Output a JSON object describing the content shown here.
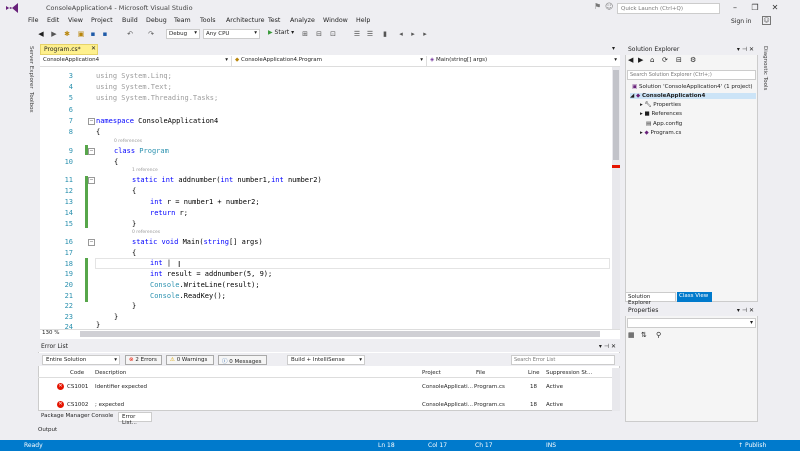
{
  "window": {
    "title": "ConsoleApplication4 - Microsoft Visual Studio",
    "quick_launch_placeholder": "Quick Launch (Ctrl+Q)",
    "sign_in": "Sign in"
  },
  "menu": [
    "File",
    "Edit",
    "View",
    "Project",
    "Build",
    "Debug",
    "Team",
    "Tools",
    "Architecture",
    "Test",
    "Analyze",
    "Window",
    "Help"
  ],
  "toolbar": {
    "config": "Debug",
    "platform": "Any CPU",
    "start": "Start"
  },
  "left_strip": [
    "Server Explorer",
    "Toolbox"
  ],
  "right_strip": [
    "Diagnostic Tools"
  ],
  "editor": {
    "tab_label": "Program.cs*",
    "nav_project": "ConsoleApplication4",
    "nav_class": "ConsoleApplication4.Program",
    "nav_member": "Main(string[] args)",
    "zoom": "130 %",
    "lines": [
      {
        "n": "3",
        "text": "using System.Linq;"
      },
      {
        "n": "4",
        "text": "using System.Text;"
      },
      {
        "n": "5",
        "text": "using System.Threading.Tasks;"
      },
      {
        "n": "6",
        "text": ""
      },
      {
        "n": "7",
        "text": "namespace ConsoleApplication4"
      },
      {
        "n": "8",
        "text": "{"
      },
      {
        "n": "9",
        "text": "class Program"
      },
      {
        "n": "10",
        "text": "{"
      },
      {
        "n": "11",
        "text": "static int addnumber(int number1,int number2)"
      },
      {
        "n": "12",
        "text": "{"
      },
      {
        "n": "13",
        "text": "int r = number1 + number2;"
      },
      {
        "n": "14",
        "text": "return r;"
      },
      {
        "n": "15",
        "text": "}"
      },
      {
        "n": "16",
        "text": "static void Main(string[] args)"
      },
      {
        "n": "17",
        "text": "{"
      },
      {
        "n": "18",
        "text": "int |"
      },
      {
        "n": "19",
        "text": "int result = addnumber(5, 9);"
      },
      {
        "n": "20",
        "text": "Console.WriteLine(result);"
      },
      {
        "n": "21",
        "text": "Console.ReadKey();"
      },
      {
        "n": "22",
        "text": "}"
      },
      {
        "n": "23",
        "text": "}"
      },
      {
        "n": "24",
        "text": "}"
      }
    ],
    "refs_0": "0 references",
    "refs_1": "1 reference",
    "refs_2": "0 references"
  },
  "solution_explorer": {
    "title": "Solution Explorer",
    "search_placeholder": "Search Solution Explorer (Ctrl+;)",
    "items": [
      "Solution 'ConsoleApplication4' (1 project)",
      "ConsoleApplication4",
      "Properties",
      "References",
      "App.config",
      "Program.cs"
    ],
    "tab_solution": "Solution Explorer",
    "tab_class": "Class View"
  },
  "properties": {
    "title": "Properties"
  },
  "error_list": {
    "title": "Error List",
    "scope": "Entire Solution",
    "errors_btn": "2 Errors",
    "warnings_btn": "0 Warnings",
    "messages_btn": "0 Messages",
    "build_filter": "Build + IntelliSense",
    "search_placeholder": "Search Error List",
    "columns": [
      "Code",
      "Description",
      "Project",
      "File",
      "Line",
      "Suppression St..."
    ],
    "rows": [
      {
        "code": "CS1001",
        "desc": "Identifier expected",
        "project": "ConsoleApplicati...",
        "file": "Program.cs",
        "line": "18",
        "supp": "Active"
      },
      {
        "code": "CS1002",
        "desc": "; expected",
        "project": "ConsoleApplicati...",
        "file": "Program.cs",
        "line": "18",
        "supp": "Active"
      }
    ]
  },
  "bottom_tabs": [
    "Package Manager Console",
    "Error List..."
  ],
  "output_label": "Output",
  "status": {
    "ready": "Ready",
    "ln": "Ln 18",
    "col": "Col 17",
    "ch": "Ch 17",
    "mode": "INS",
    "publish": "Publish"
  },
  "colors": {
    "accent": "#007acc",
    "brand": "#68217a",
    "tab_modified": "#fef08c"
  }
}
